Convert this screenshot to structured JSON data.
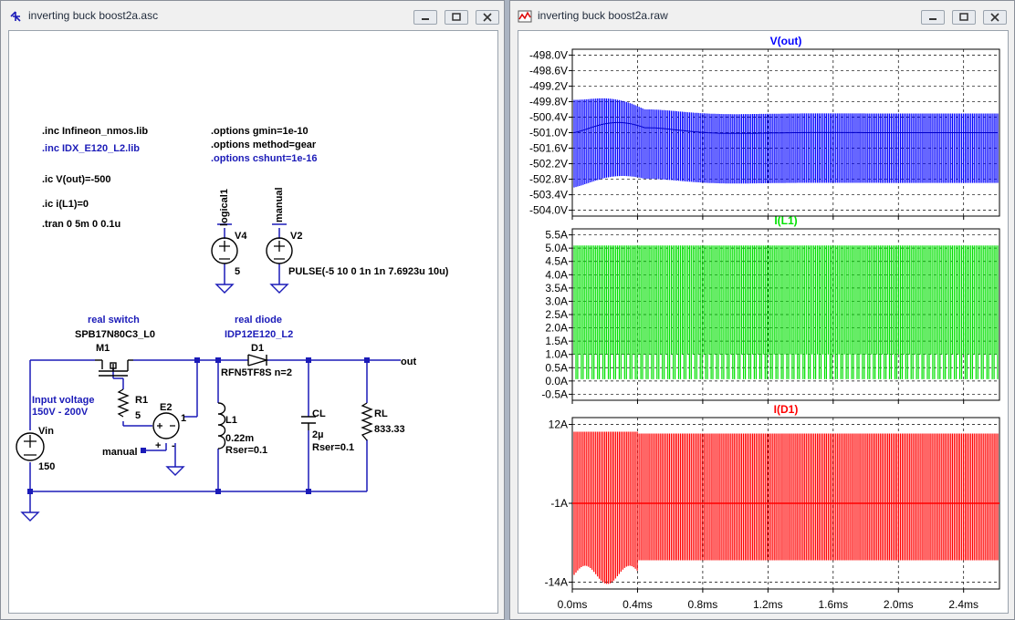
{
  "schematic_window": {
    "title": "inverting buck boost2a.asc",
    "directives": {
      "inc1": ".inc Infineon_nmos.lib",
      "inc2": ".inc IDX_E120_L2.lib",
      "ic1": ".ic V(out)=-500",
      "ic2": ".ic i(L1)=0",
      "tran": ".tran 0 5m 0 0.1u",
      "opt1": ".options gmin=1e-10",
      "opt2": ".options method=gear",
      "opt3": ".options cshunt=1e-16"
    },
    "labels": {
      "logical1": "logical1",
      "manual_net": "manual",
      "v4": "V4",
      "v4_val": "5",
      "v2": "V2",
      "v2_val": "PULSE(-5 10 0 1n 1n 7.6923u 10u)",
      "real_switch": "real switch",
      "mosfet_model": "SPB17N80C3_L0",
      "m1": "M1",
      "real_diode": "real diode",
      "diode_model": "IDP12E120_L2",
      "d1": "D1",
      "diode_param": "RFN5TF8S n=2",
      "out": "out",
      "input_voltage": "Input voltage",
      "input_range": "150V - 200V",
      "r1": "R1",
      "r1_val": "5",
      "e2": "E2",
      "e2_val": "1",
      "manual": "manual",
      "vin": "Vin",
      "vin_val": "150",
      "l1": "L1",
      "l1_val": "0.22m",
      "l1_rser": "Rser=0.1",
      "cl": "CL",
      "cl_val": "2µ",
      "cl_rser": "Rser=0.1",
      "rl": "RL",
      "rl_val": "833.33"
    }
  },
  "waveform_window": {
    "title": "inverting buck boost2a.raw",
    "x_ticks": [
      "0.0ms",
      "0.4ms",
      "0.8ms",
      "1.2ms",
      "1.6ms",
      "2.0ms",
      "2.4ms"
    ],
    "panes": [
      {
        "title": "V(out)",
        "color": "#0000ff",
        "ticks": [
          "-498.0V",
          "-498.6V",
          "-499.2V",
          "-499.8V",
          "-500.4V",
          "-501.0V",
          "-501.6V",
          "-502.2V",
          "-502.8V",
          "-503.4V",
          "-504.0V"
        ]
      },
      {
        "title": "I(L1)",
        "color": "#00e000",
        "ticks": [
          "5.5A",
          "5.0A",
          "4.5A",
          "4.0A",
          "3.5A",
          "3.0A",
          "2.5A",
          "2.0A",
          "1.5A",
          "1.0A",
          "0.5A",
          "0.0A",
          "-0.5A"
        ]
      },
      {
        "title": "I(D1)",
        "color": "#ff0000",
        "ticks": [
          "12A",
          "-1A",
          "-14A"
        ]
      }
    ]
  },
  "colors": {
    "trace_vout": "#0000ff",
    "trace_il1": "#00e000",
    "trace_id1": "#ff0000",
    "wire": "#1b1bb8",
    "text_blue": "#1b1bb8"
  },
  "icons": [
    "ltspice-schematic-icon",
    "ltspice-waveform-icon",
    "minimize-icon",
    "maximize-icon",
    "close-icon"
  ]
}
